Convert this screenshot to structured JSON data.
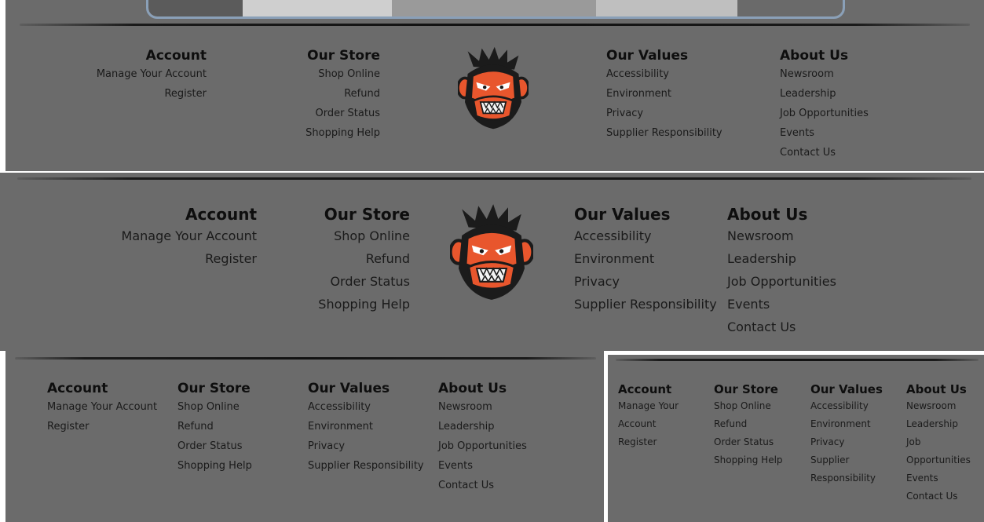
{
  "colors": {
    "panel": "#6b6b6b",
    "text": "#111111",
    "face": "#e8562d",
    "fur": "#1b1b1b"
  },
  "logo": {
    "icon": "monkey-face-icon"
  },
  "footer": {
    "account": {
      "heading": "Account",
      "links": [
        "Manage Your Account",
        "Register"
      ]
    },
    "store": {
      "heading": "Our Store",
      "links": [
        "Shop Online",
        "Refund",
        "Order Status",
        "Shopping Help"
      ]
    },
    "values": {
      "heading": "Our Values",
      "links": [
        "Accessibility",
        "Environment",
        "Privacy",
        "Supplier Responsibility"
      ]
    },
    "about": {
      "heading": "About Us",
      "links": [
        "Newsroom",
        "Leadership",
        "Job Opportunities",
        "Events",
        "Contact Us"
      ]
    }
  },
  "narrow": {
    "account_links": [
      "Manage Your",
      "Account",
      "Register"
    ],
    "values_links": [
      "Accessibility",
      "Environment",
      "Privacy",
      "Supplier",
      "Responsibility"
    ],
    "about_links": [
      "Newsroom",
      "Leadership",
      "Job",
      "Opportunities",
      "Events",
      "Contact Us"
    ]
  }
}
